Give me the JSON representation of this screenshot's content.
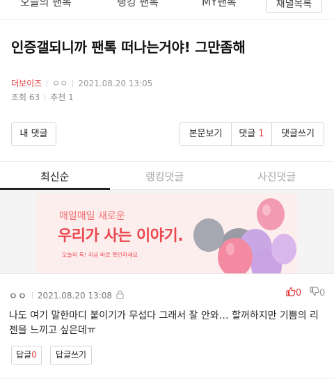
{
  "top_nav": {
    "tabs": [
      "오늘의 팬톡",
      "랭킹 팬톡",
      "MY팬톡"
    ],
    "more_button": "채널목록"
  },
  "post": {
    "title": "인증갤되니까 팬톡 떠나는거야! 그만좀해",
    "channel": "더보이즈",
    "author": "ㅇㅇ",
    "datetime": "2021.08.20 13:05",
    "views_label": "조회",
    "views": "63",
    "recommend_label": "추천",
    "recommend": "1"
  },
  "actions": {
    "my_comments": "내 댓글",
    "view_body": "본문보기",
    "comments_label": "댓글",
    "comments_count": "1",
    "write_comment": "댓글쓰기"
  },
  "comment_tabs": [
    "최신순",
    "랭킹댓글",
    "사진댓글"
  ],
  "ad": {
    "line1": "매일매일 새로운",
    "line2": "우리가 사는 이야기.",
    "line3": "오늘의 톡! 지금 바로 확인하세요"
  },
  "comment": {
    "author": "ㅇㅇ",
    "datetime": "2021.08.20 13:08",
    "upvotes": "0",
    "downvotes": "0",
    "text": "나도 여기 말한마디 붙이기가 무섭다 그래서 잘 안와… 할꺼하지만 기쁨의 리젠을 느끼고 싶은데ㅠ",
    "reply_label": "답글",
    "reply_count": "0",
    "write_reply": "답글쓰기"
  },
  "colors": {
    "accent_red": "#e5383b",
    "ad_background": "#fdeeee",
    "balloon_pink": "#f48aa2",
    "balloon_purple": "#c9a6e4",
    "balloon_gray": "#9a9ba5"
  }
}
